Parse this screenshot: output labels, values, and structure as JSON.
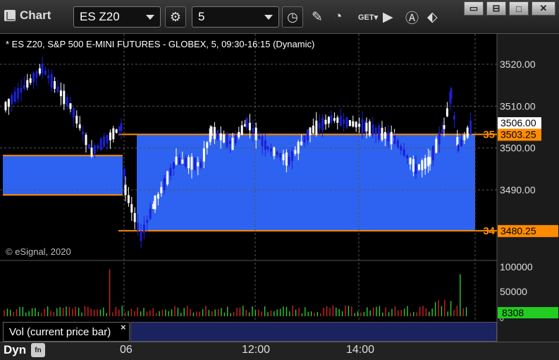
{
  "window": {
    "title": "Chart",
    "symbol": "ES Z20",
    "interval": "5"
  },
  "chart": {
    "header": "* ES Z20, S&P 500 E-MINI FUTURES - GLOBEX, 5, 09:30-16:15 (Dynamic)",
    "copyright": "© eSignal, 2020",
    "price_labels": [
      "3520.00",
      "3510.00",
      "3500.00",
      "3490.00"
    ],
    "volume_labels": [
      "100000",
      "50000",
      "0"
    ],
    "time_labels": [
      "06",
      "12:00",
      "14:00"
    ],
    "current_price": "3506.00",
    "level_35_price": "3503.25",
    "level_35_tag": "35",
    "level_34_price": "3480.25",
    "level_34_tag": "34",
    "volume_value": "8308",
    "volume_study_label": "Vol (current price bar)",
    "close_x": "×",
    "dyn_label": "Dyn",
    "dyn_icon": "fn",
    "colors": {
      "up": "#ffffff",
      "down": "#1a20d8",
      "zone": "#2e62f0",
      "level": "#ff8c00",
      "volume_up": "#2ecc2e",
      "volume_down": "#d82020",
      "volume_label_bg": "#22cc22"
    }
  },
  "chart_data": {
    "type": "candlestick",
    "ylim": [
      3476,
      3526
    ],
    "y_ticks": [
      3490,
      3500,
      3510,
      3520
    ],
    "levels": [
      3503.25,
      3480.25
    ],
    "current_price": 3506.0,
    "volume_ylim": [
      0,
      120000
    ],
    "volume_ticks": [
      0,
      50000,
      100000
    ],
    "last_volume": 8308,
    "x_labels": [
      "06",
      "12:00",
      "14:00"
    ]
  }
}
